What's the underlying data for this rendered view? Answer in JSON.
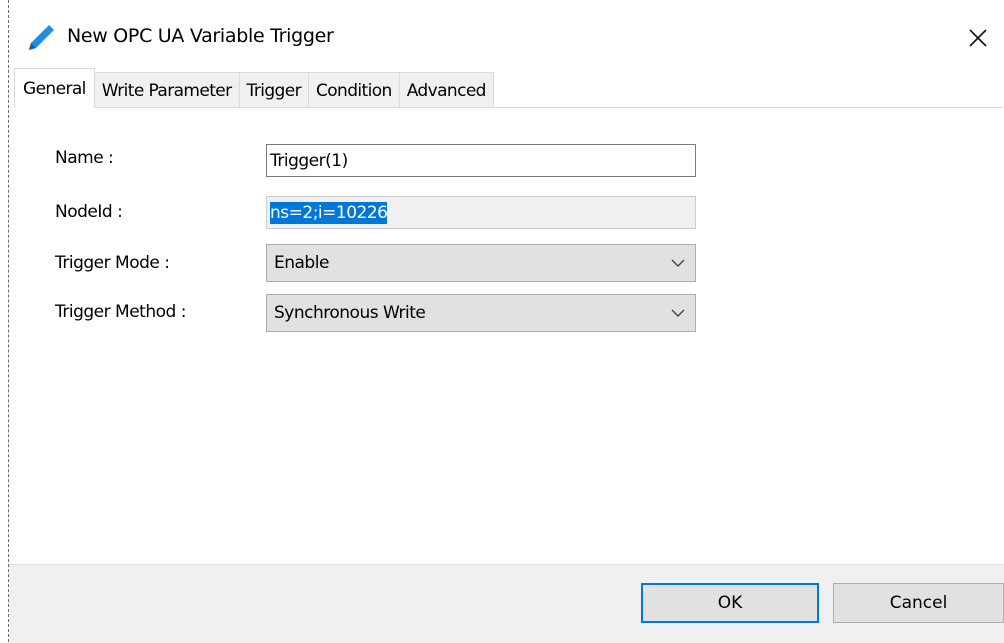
{
  "window": {
    "title": "New OPC UA Variable Trigger",
    "icon": "pencil-icon",
    "close_icon": "close-icon",
    "accent_color": "#0078d7"
  },
  "tabs": [
    {
      "label": "General",
      "active": true
    },
    {
      "label": "Write Parameter",
      "active": false
    },
    {
      "label": "Trigger",
      "active": false
    },
    {
      "label": "Condition",
      "active": false
    },
    {
      "label": "Advanced",
      "active": false
    }
  ],
  "form": {
    "name": {
      "label": "Name :",
      "value": "Trigger(1)"
    },
    "node_id": {
      "label": "NodeId :",
      "value": "ns=2;i=10226"
    },
    "trigger_mode": {
      "label": "Trigger Mode :",
      "value": "Enable"
    },
    "trigger_method": {
      "label": "Trigger Method :",
      "value": "Synchronous Write"
    }
  },
  "footer": {
    "ok_label": "OK",
    "cancel_label": "Cancel"
  }
}
